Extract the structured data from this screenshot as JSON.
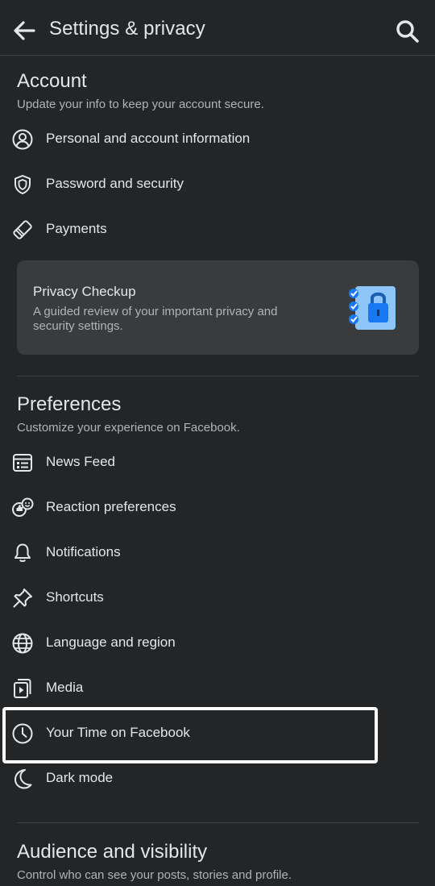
{
  "header": {
    "title": "Settings & privacy"
  },
  "account": {
    "title": "Account",
    "subtitle": "Update your info to keep your account secure.",
    "items": [
      {
        "label": "Personal and account information",
        "icon": "person-circle-icon"
      },
      {
        "label": "Password and security",
        "icon": "shield-icon"
      },
      {
        "label": "Payments",
        "icon": "tag-icon"
      }
    ],
    "card": {
      "title": "Privacy Checkup",
      "description": "A guided review of your important privacy and security settings.",
      "icon": "lock-checklist-icon"
    }
  },
  "preferences": {
    "title": "Preferences",
    "subtitle": "Customize your experience on Facebook.",
    "items": [
      {
        "label": "News Feed",
        "icon": "feed-icon"
      },
      {
        "label": "Reaction preferences",
        "icon": "reaction-icon"
      },
      {
        "label": "Notifications",
        "icon": "bell-icon"
      },
      {
        "label": "Shortcuts",
        "icon": "pin-icon"
      },
      {
        "label": "Language and region",
        "icon": "globe-icon"
      },
      {
        "label": "Media",
        "icon": "media-icon"
      },
      {
        "label": "Your Time on Facebook",
        "icon": "clock-icon"
      },
      {
        "label": "Dark mode",
        "icon": "moon-icon"
      }
    ]
  },
  "audience": {
    "title": "Audience and visibility",
    "subtitle": "Control who can see your posts, stories and profile."
  },
  "colors": {
    "background": "#242526",
    "card": "#3a3b3c",
    "text_primary": "#e4e6eb",
    "text_secondary": "#b0b3b8",
    "accent_blue": "#1877f2",
    "highlight": "#ffffff"
  }
}
